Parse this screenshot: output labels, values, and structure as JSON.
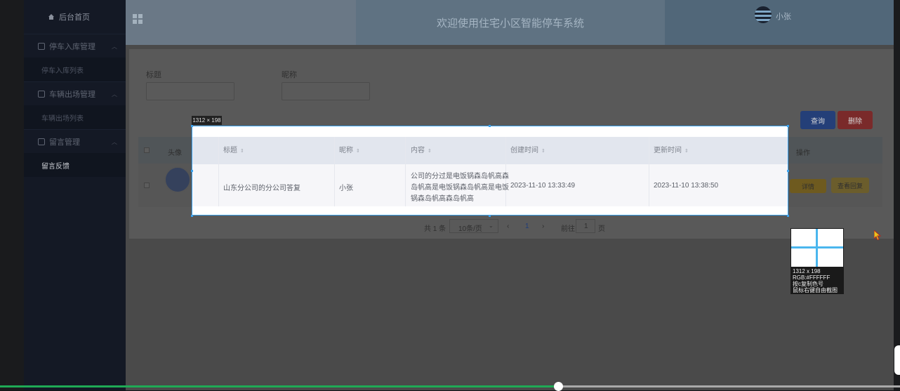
{
  "sidebar": {
    "home": "后台首页",
    "groups": [
      {
        "label": "停车入库管理",
        "sub": "停车入库列表"
      },
      {
        "label": "车辆出场管理",
        "sub": "车辆出场列表"
      },
      {
        "label": "留言管理",
        "sub": "留言反馈"
      }
    ]
  },
  "header": {
    "title": "欢迎使用住宅小区智能停车系统",
    "user": "小张"
  },
  "search": {
    "title_label": "标题",
    "nickname_label": "昵称",
    "query_button": "查询",
    "delete_button": "删除"
  },
  "table": {
    "columns": {
      "avatar": "头像",
      "title": "标题",
      "nickname": "昵称",
      "content": "内容",
      "created": "创建时间",
      "updated": "更新时间",
      "actions": "操作"
    },
    "row": {
      "title": "山东分公司的分公司答复",
      "nickname": "小张",
      "content_line1": "公司的分过是电饭锅森岛帆高森",
      "content_line2": "岛帆高是电饭锅森岛帆高是电饭",
      "content_line3": "锅森岛帆高森岛帆高",
      "created": "2023-11-10 13:33:49",
      "updated": "2023-11-10 13:38:50",
      "detail_button": "详情",
      "reply_button": "查看回复"
    }
  },
  "pagination": {
    "total": "共 1 条",
    "page_size": "10条/页",
    "current_page": "1",
    "goto_label": "前往",
    "goto_value": "1",
    "page_suffix": "页"
  },
  "screenshot_tool": {
    "size_label": "1312 × 198",
    "mag_size": "1312 x 198",
    "mag_rgb": "RGB:#FFFFFF",
    "mag_copy": "按c复制色号",
    "mag_hint": "鼠标右键自由截图"
  },
  "progress": {
    "value": 0.62
  }
}
